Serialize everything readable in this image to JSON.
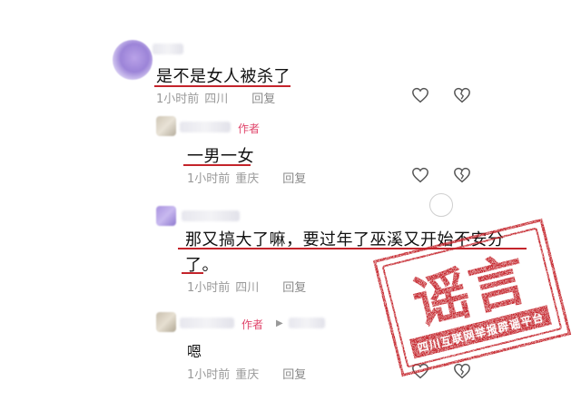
{
  "comments": [
    {
      "text": "是不是女人被杀了",
      "time": "1小时前",
      "location": "四川",
      "reply_label": "回复"
    },
    {
      "author_tag": "作者",
      "text": "一男一女",
      "time": "1小时前",
      "location": "重庆",
      "reply_label": "回复"
    },
    {
      "text_line1": "那又搞大了嘛，要过年了巫溪又开始不安分",
      "text_line2": "了。",
      "time": "1小时前",
      "location": "四川",
      "reply_label": "回复"
    },
    {
      "author_tag": "作者",
      "text": "嗯",
      "time": "1小时前",
      "location": "重庆",
      "reply_label": "回复"
    }
  ],
  "stamp": {
    "main": "谣言",
    "sub": "四川互联网举报辟谣平台",
    "color": "#c4242b"
  },
  "colors": {
    "author_tag": "#e0456b",
    "underline": "#c4242b",
    "meta": "#9a9a9a"
  }
}
